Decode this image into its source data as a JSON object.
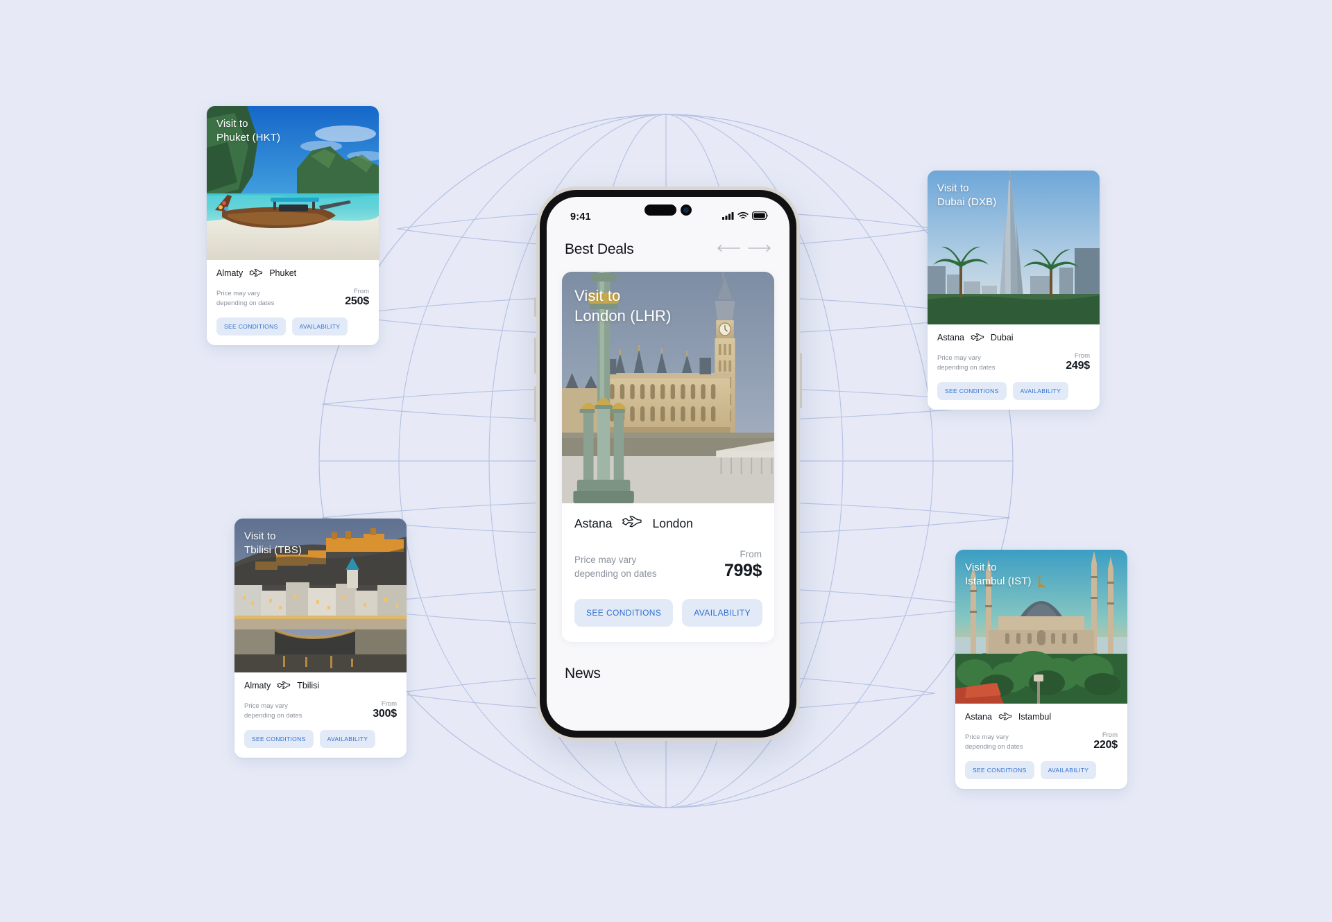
{
  "background": {
    "color": "#e7eaf6",
    "decoration": "globe-wireframe",
    "line_color": "#aebbe2"
  },
  "phone": {
    "status_bar": {
      "time": "9:41",
      "icons": [
        "cellular-signal-icon",
        "wifi-icon",
        "battery-icon"
      ]
    },
    "header": {
      "title": "Best Deals",
      "nav": {
        "prev": "arrow-left-icon",
        "next": "arrow-right-icon"
      }
    },
    "featured_deal": {
      "overlay_title_line1": "Visit to",
      "overlay_title_line2": "London (LHR)",
      "origin": "Astana",
      "destination": "London",
      "price_note_line1": "Price may vary",
      "price_note_line2": "depending on dates",
      "from_label": "From",
      "price": "799$",
      "btn_conditions": "SEE CONDITIONS",
      "btn_availability": "AVAILABILITY",
      "photo": "london-big-ben-parliament"
    },
    "news_section_title": "News"
  },
  "accent": {
    "button_bg": "#e3eaf7",
    "button_text": "#2f6fd0",
    "muted_text": "#8b929c",
    "primary_text": "#14181f"
  },
  "cards": [
    {
      "id": "phuket",
      "overlay_title_line1": "Visit to",
      "overlay_title_line2": "Phuket (HKT)",
      "origin": "Almaty",
      "destination": "Phuket",
      "price_note_line1": "Price may vary",
      "price_note_line2": "depending on dates",
      "from_label": "From",
      "price": "250$",
      "btn_conditions": "SEE CONDITIONS",
      "btn_availability": "AVAILABILITY",
      "photo": "phuket-longtail-boat-beach"
    },
    {
      "id": "dubai",
      "overlay_title_line1": "Visit to",
      "overlay_title_line2": "Dubai (DXB)",
      "origin": "Astana",
      "destination": "Dubai",
      "price_note_line1": "Price may vary",
      "price_note_line2": "depending on dates",
      "from_label": "From",
      "price": "249$",
      "btn_conditions": "SEE CONDITIONS",
      "btn_availability": "AVAILABILITY",
      "photo": "dubai-burj-khalifa-palms"
    },
    {
      "id": "tbilisi",
      "overlay_title_line1": "Visit to",
      "overlay_title_line2": "Tbilisi (TBS)",
      "origin": "Almaty",
      "destination": "Tbilisi",
      "price_note_line1": "Price may vary",
      "price_note_line2": "depending on dates",
      "from_label": "From",
      "price": "300$",
      "btn_conditions": "SEE CONDITIONS",
      "btn_availability": "AVAILABILITY",
      "photo": "tbilisi-fortress-bridge-dusk"
    },
    {
      "id": "istambul",
      "overlay_title_line1": "Visit to",
      "overlay_title_line2": "Istambul (IST)",
      "origin": "Astana",
      "destination": "Istambul",
      "price_note_line1": "Price may vary",
      "price_note_line2": "depending on dates",
      "from_label": "From",
      "price": "220$",
      "btn_conditions": "SEE CONDITIONS",
      "btn_availability": "AVAILABILITY",
      "photo": "istanbul-blue-mosque-sunset"
    }
  ]
}
